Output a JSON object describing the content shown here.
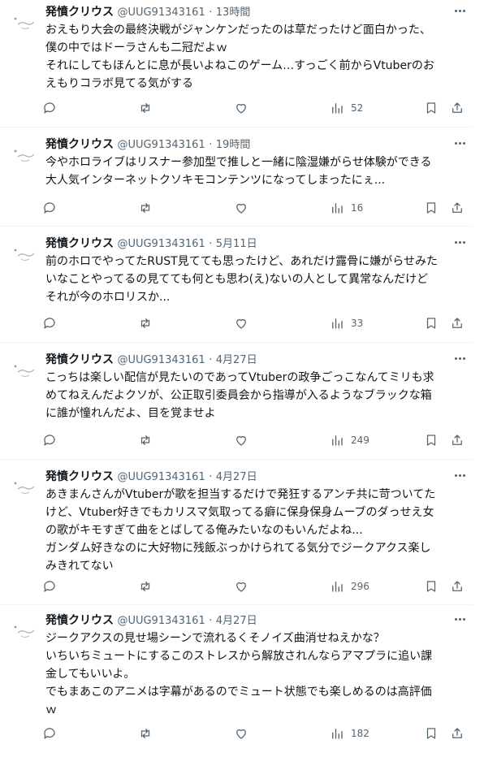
{
  "tweets": [
    {
      "name": "発憤クリウス",
      "handle": "@UUG91343161",
      "sep": "·",
      "time": "13時間",
      "lines": [
        "おえもり大会の最終決戦がジャンケンだったのは草だったけど面白かった、",
        "僕の中ではドーラさんも二冠だよｗ",
        "それにしてもほんとに息が長いよねこのゲーム…すっごく前からVtuberのお",
        "えもりコラボ見てる気がする"
      ],
      "views": "52"
    },
    {
      "name": "発憤クリウス",
      "handle": "@UUG91343161",
      "sep": "·",
      "time": "19時間",
      "lines": [
        "今やホロライブはリスナー参加型で推しと一緒に陰湿嫌がらせ体験ができる",
        "大人気インターネットクソキモコンテンツになってしまったにぇ..."
      ],
      "views": "16"
    },
    {
      "name": "発憤クリウス",
      "handle": "@UUG91343161",
      "sep": "·",
      "time": "5月11日",
      "lines": [
        "前のホロでやってたRUST見てても思ったけど、あれだけ露骨に嫌がらせみた",
        "いなことやってるの見てても何とも思わ(え)ないの人として異常なんだけど",
        "それが今のホロリスか..."
      ],
      "views": "33"
    },
    {
      "name": "発憤クリウス",
      "handle": "@UUG91343161",
      "sep": "·",
      "time": "4月27日",
      "lines": [
        "こっちは楽しい配信が見たいのであってVtuberの政争ごっこなんてミリも求",
        "めてねえんだよクソが、公正取引委員会から指導が入るようなブラックな箱",
        "に誰が憧れんだよ、目を覚ませよ"
      ],
      "views": "249"
    },
    {
      "name": "発憤クリウス",
      "handle": "@UUG91343161",
      "sep": "·",
      "time": "4月27日",
      "lines": [
        "あきまんさんがVtuberが歌を担当するだけで発狂するアンチ共に苛ついてた",
        "けど、Vtuber好きでもカリスマ気取ってる癖に保身保身ムーブのダっせえ女",
        "の歌がキモすぎて曲をとばしてる俺みたいなのもいんだよね...",
        "ガンダム好きなのに大好物に残飯ぶっかけられてる気分でジークアクス楽し",
        "みきれてない"
      ],
      "views": "296"
    },
    {
      "name": "発憤クリウス",
      "handle": "@UUG91343161",
      "sep": "·",
      "time": "4月27日",
      "lines": [
        "ジークアクスの見せ場シーンで流れるくそノイズ曲消せねえかな？",
        "いちいちミュートにするこのストレスから解放されんならアマプラに追い課",
        "金してもいいよ。",
        "でもまあこのアニメは字幕があるのでミュート状態でも楽しめるのは高評価",
        "ｗ"
      ],
      "views": "182"
    }
  ],
  "icons": {
    "avatar": "avatar-scribble-icon",
    "more": "more-dots-icon",
    "reply": "reply-icon",
    "retweet": "retweet-icon",
    "like": "like-icon",
    "views": "views-icon",
    "bookmark": "bookmark-icon",
    "share": "share-icon"
  },
  "colors": {
    "text": "#0f1419",
    "secondary": "#536471",
    "divider": "#eff3f4"
  }
}
